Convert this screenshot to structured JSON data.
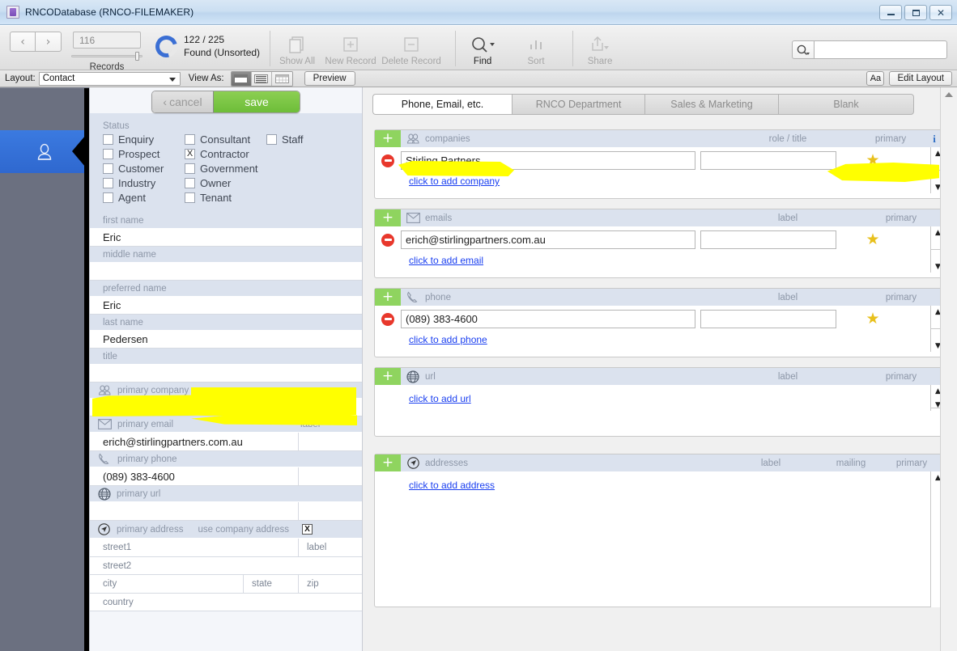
{
  "window": {
    "title": "RNCODatabase (RNCO-FILEMAKER)",
    "app_icon": "filemaker-icon",
    "minimize": "minimize-icon",
    "maximize": "maximize-icon",
    "close": "close-icon"
  },
  "toolbar": {
    "prev_label": "‹",
    "next_label": "›",
    "record_number": "116",
    "records_label": "Records",
    "found_count": "122 / 225",
    "found_status": "Found (Unsorted)",
    "items": [
      {
        "label": "Show All",
        "icon": "show-all-icon",
        "enabled": false
      },
      {
        "label": "New Record",
        "icon": "new-record-icon",
        "enabled": false
      },
      {
        "label": "Delete Record",
        "icon": "delete-record-icon",
        "enabled": false
      },
      {
        "label": "Find",
        "icon": "find-icon",
        "enabled": true
      },
      {
        "label": "Sort",
        "icon": "sort-icon",
        "enabled": false
      },
      {
        "label": "Share",
        "icon": "share-icon",
        "enabled": false
      }
    ],
    "search_value": "",
    "search_placeholder": ""
  },
  "layoutbar": {
    "layout_label": "Layout:",
    "layout_value": "Contact",
    "view_as_label": "View As:",
    "view_modes": [
      "view-as-form",
      "view-as-list",
      "view-as-table"
    ],
    "active_view_mode": 0,
    "preview_label": "Preview",
    "text_format_label": "Aa",
    "edit_layout_label": "Edit Layout"
  },
  "rail": {
    "items": [
      {
        "name": "contact-rail-item",
        "icon": "person-icon",
        "active": true
      }
    ]
  },
  "form": {
    "cancel_label": "cancel",
    "save_label": "save",
    "status_title": "Status",
    "status_options": [
      {
        "label": "Enquiry",
        "checked": false
      },
      {
        "label": "Consultant",
        "checked": false
      },
      {
        "label": "Staff",
        "checked": false
      },
      {
        "label": "Prospect",
        "checked": false
      },
      {
        "label": "Contractor",
        "checked": true
      },
      {
        "label": "Customer",
        "checked": false
      },
      {
        "label": "Government",
        "checked": false
      },
      {
        "label": "Industry",
        "checked": false
      },
      {
        "label": "Owner",
        "checked": false
      },
      {
        "label": "Agent",
        "checked": false
      },
      {
        "label": "Tenant",
        "checked": false
      }
    ],
    "fields": [
      {
        "label": "first name",
        "value": "Eric"
      },
      {
        "label": "middle name",
        "value": ""
      },
      {
        "label": "preferred name",
        "value": "Eric"
      },
      {
        "label": "last name",
        "value": "Pedersen"
      },
      {
        "label": "title",
        "value": ""
      }
    ],
    "primary_company_label": "primary company",
    "primary_company_value": "",
    "primary_company_icon": "company-icon",
    "primary_email_label": "primary email",
    "primary_email_value": "erich@stirlingpartners.com.au",
    "primary_email_icon": "envelope-icon",
    "primary_phone_label": "primary phone",
    "primary_phone_value": "(089) 383-4600",
    "primary_phone_icon": "phone-icon",
    "primary_url_label": "primary url",
    "primary_url_value": "",
    "primary_url_icon": "globe-icon",
    "label_col_label": "label",
    "address_header": {
      "icon": "compass-icon",
      "title": "primary address",
      "action": "use company  address",
      "clear": "X"
    },
    "address_fields": {
      "street1": "street1",
      "street1_label": "label",
      "street2": "street2",
      "city": "city",
      "state": "state",
      "zip": "zip",
      "country": "country"
    }
  },
  "main": {
    "tabs": [
      {
        "label": "Phone, Email, etc.",
        "active": true
      },
      {
        "label": "RNCO Department",
        "active": false
      },
      {
        "label": "Sales & Marketing",
        "active": false
      },
      {
        "label": "Blank",
        "active": false
      }
    ],
    "panels": [
      {
        "name": "companies",
        "icon": "company-icon",
        "title": "companies",
        "columns": [
          "role / title",
          "primary"
        ],
        "info_icon": "info-icon",
        "has_info": true,
        "rows": [
          {
            "value": "Stirling Partners",
            "label": "",
            "primary": true
          }
        ],
        "add_link": "click to add company"
      },
      {
        "name": "emails",
        "icon": "envelope-icon",
        "title": "emails",
        "columns": [
          "label",
          "primary"
        ],
        "has_info": false,
        "rows": [
          {
            "value": "erich@stirlingpartners.com.au",
            "label": "",
            "primary": true
          }
        ],
        "add_link": "click to add email"
      },
      {
        "name": "phone",
        "icon": "phone-icon",
        "title": "phone",
        "columns": [
          "label",
          "primary"
        ],
        "has_info": false,
        "rows": [
          {
            "value": "(089) 383-4600",
            "label": "",
            "primary": true
          }
        ],
        "add_link": "click to add phone"
      },
      {
        "name": "url",
        "icon": "globe-icon",
        "title": "url",
        "columns": [
          "label",
          "primary"
        ],
        "has_info": false,
        "rows": [],
        "add_link": "click to add url"
      },
      {
        "name": "addresses",
        "icon": "compass-icon",
        "title": "addresses",
        "columns": [
          "label",
          "mailing",
          "primary"
        ],
        "has_info": false,
        "rows": [],
        "add_link": "click to add address"
      }
    ]
  },
  "colors": {
    "accent_blue": "#3b7ae0",
    "save_green": "#6dbd39",
    "add_green": "#8fd45f",
    "remove_red": "#e8382c",
    "star_yellow": "#e8c01c",
    "highlight_yellow": "#ffff00",
    "label_bg": "#dbe2ee",
    "label_text": "#8d97a8",
    "link_blue": "#1a3ff0"
  }
}
